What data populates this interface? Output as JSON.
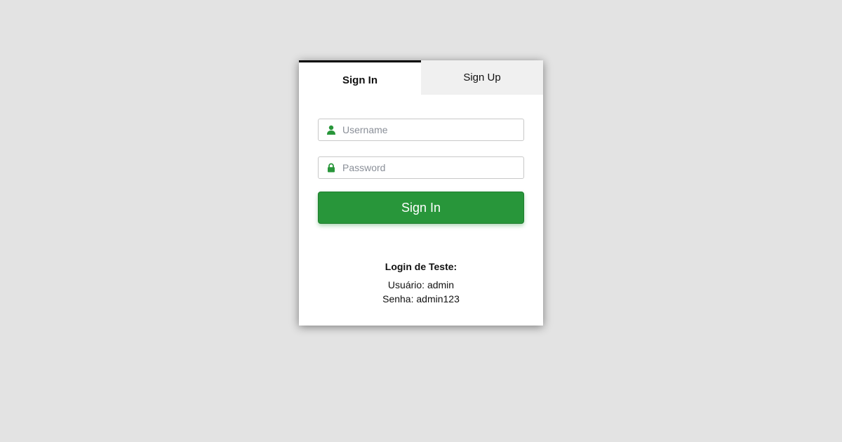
{
  "tabs": {
    "signin_label": "Sign In",
    "signup_label": "Sign Up"
  },
  "form": {
    "username_placeholder": "Username",
    "password_placeholder": "Password",
    "submit_label": "Sign In"
  },
  "test_login": {
    "heading": "Login de Teste:",
    "user_line": "Usuário: admin",
    "password_line": "Senha: admin123"
  },
  "icons": {
    "username": "user-icon",
    "password": "lock-icon"
  },
  "colors": {
    "accent": "#28963a",
    "background": "#e3e3e3",
    "tab_inactive": "#f0f0f0"
  }
}
